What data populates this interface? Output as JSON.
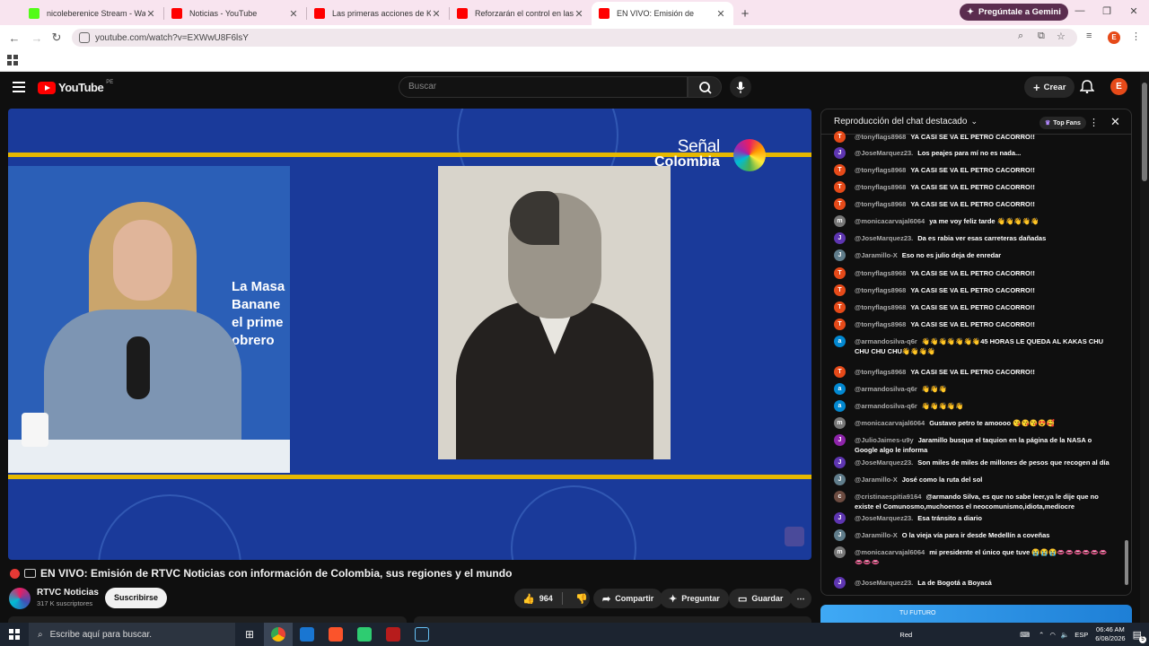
{
  "browser": {
    "tabs": [
      {
        "title": "nicoleberenice Stream - Watch",
        "favicon_color": "#53fc18",
        "active": false
      },
      {
        "title": "Noticias - YouTube",
        "favicon_color": "#ff0000",
        "active": false
      },
      {
        "title": "Las primeras acciones de Keiko",
        "favicon_color": "#ff0000",
        "active": false
      },
      {
        "title": "Reforzarán el control en las fro",
        "favicon_color": "#ff0000",
        "active": false
      },
      {
        "title": "EN VIVO: Emisión de",
        "favicon_color": "#ff0000",
        "active": true
      }
    ],
    "new_tab": "+",
    "gemini_label": "Pregúntale a Gemini",
    "url": "youtube.com/watch?v=EXWwU8F6lsY",
    "profile_initial": "E"
  },
  "youtube": {
    "logo_text": "YouTube",
    "country_code": "PE",
    "search_placeholder": "Buscar",
    "create_label": "Crear",
    "avatar_initial": "E"
  },
  "video": {
    "inset_text_line1": "La Masa",
    "inset_text_line2": "Banane",
    "inset_text_line3": "el prime",
    "inset_text_line4": "obrero",
    "channel_logo_line1": "Señal",
    "channel_logo_line2": "Colombia",
    "title": "EN VIVO: Emisión de RTVC Noticias con información de Colombia, sus regiones y el mundo",
    "channel_name": "RTVC Noticias",
    "subscribers": "317 K suscriptores",
    "subscribe_label": "Suscribirse",
    "likes": "964",
    "share_label": "Compartir",
    "ask_label": "Preguntar",
    "save_label": "Guardar"
  },
  "chat": {
    "header": "Reproducción del chat destacado",
    "top_fans_label": "Top Fans",
    "messages": [
      {
        "initial": "T",
        "color": "#e64a19",
        "author": "@tonyflags8968",
        "text": "YA CASI SE VA EL PETRO CACORRO!!"
      },
      {
        "initial": "J",
        "color": "#5e35b1",
        "author": "@JoseMarquez23.",
        "text": "Los peajes para mí no es nada..."
      },
      {
        "initial": "T",
        "color": "#e64a19",
        "author": "@tonyflags8968",
        "text": "YA CASI SE VA EL PETRO CACORRO!!"
      },
      {
        "initial": "T",
        "color": "#e64a19",
        "author": "@tonyflags8968",
        "text": "YA CASI SE VA EL PETRO CACORRO!!"
      },
      {
        "initial": "T",
        "color": "#e64a19",
        "author": "@tonyflags8968",
        "text": "YA CASI SE VA EL PETRO CACORRO!!"
      },
      {
        "initial": "m",
        "color": "#777777",
        "author": "@monicacarvajal6064",
        "text": "ya me voy feliz tarde 👋👋👋👋👋"
      },
      {
        "initial": "J",
        "color": "#5e35b1",
        "author": "@JoseMarquez23.",
        "text": "Da es rabia ver esas carreteras dañadas"
      },
      {
        "initial": "J",
        "color": "#607d8b",
        "author": "@Jaramillo-X",
        "text": "Eso no es julio deja de enredar"
      },
      {
        "initial": "T",
        "color": "#e64a19",
        "author": "@tonyflags8968",
        "text": "YA CASI SE VA EL PETRO CACORRO!!"
      },
      {
        "initial": "T",
        "color": "#e64a19",
        "author": "@tonyflags8968",
        "text": "YA CASI SE VA EL PETRO CACORRO!!"
      },
      {
        "initial": "T",
        "color": "#e64a19",
        "author": "@tonyflags8968",
        "text": "YA CASI SE VA EL PETRO CACORRO!!"
      },
      {
        "initial": "T",
        "color": "#e64a19",
        "author": "@tonyflags8968",
        "text": "YA CASI SE VA EL PETRO CACORRO!!"
      },
      {
        "initial": "a",
        "color": "#0288d1",
        "author": "@armandosilva-q6r",
        "text": "👋👋👋👋👋👋👋45 HORAS LE QUEDA AL KAKAS CHU CHU CHU CHU👋👋👋👋"
      },
      {
        "initial": "T",
        "color": "#e64a19",
        "author": "@tonyflags8968",
        "text": "YA CASI SE VA EL PETRO CACORRO!!"
      },
      {
        "initial": "a",
        "color": "#0288d1",
        "author": "@armandosilva-q6r",
        "text": "👋👋👋"
      },
      {
        "initial": "a",
        "color": "#0288d1",
        "author": "@armandosilva-q6r",
        "text": "👋👋👋👋👋"
      },
      {
        "initial": "m",
        "color": "#777777",
        "author": "@monicacarvajal6064",
        "text": "Gustavo petro te amoooo 😘😘😘😍🥰"
      },
      {
        "initial": "J",
        "color": "#8e24aa",
        "author": "@JulioJaimes-u9y",
        "text": "Jaramillo busque el taquion en la página de la NASA o Google algo le informa"
      },
      {
        "initial": "J",
        "color": "#5e35b1",
        "author": "@JoseMarquez23.",
        "text": "Son miles de miles de millones de pesos que recogen al día"
      },
      {
        "initial": "J",
        "color": "#607d8b",
        "author": "@Jaramillo-X",
        "text": "José como la ruta del sol"
      },
      {
        "initial": "c",
        "color": "#6d4c41",
        "author": "@cristinaespitia9164",
        "text": "@armando Silva, es que no sabe leer,ya le dije que no existe el Comunosmo,muchoenos el neocomunismo,idiota,mediocre"
      },
      {
        "initial": "J",
        "color": "#5e35b1",
        "author": "@JoseMarquez23.",
        "text": "Esa tránsito a diario"
      },
      {
        "initial": "J",
        "color": "#607d8b",
        "author": "@Jaramillo-X",
        "text": "O la vieja vía para ir desde Medellín a coveñas"
      },
      {
        "initial": "m",
        "color": "#777777",
        "author": "@monicacarvajal6064",
        "text": "mi presidente el único que tuve 😭😭😭👄👄👄👄👄👄👄👄👄"
      },
      {
        "initial": "J",
        "color": "#5e35b1",
        "author": "@JoseMarquez23.",
        "text": "La de Bogotá a Boyacá"
      }
    ],
    "banner_text": "TU FUTURO"
  },
  "taskbar": {
    "search_placeholder": "Escribe aquí para buscar.",
    "network_label": "Red",
    "language": "ESP",
    "time": "06:46 AM",
    "date": "6/08/2026",
    "notifications": "5"
  }
}
